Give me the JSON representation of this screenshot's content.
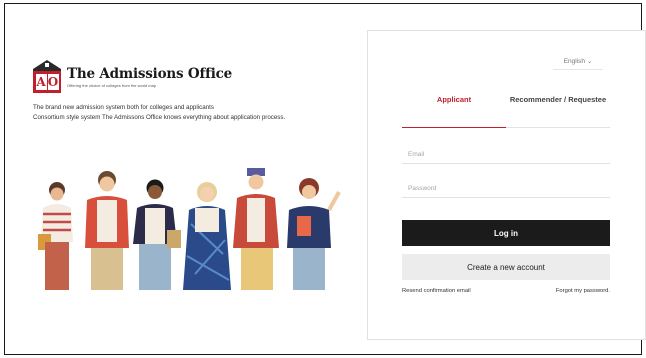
{
  "brand": {
    "logo_letters": [
      "A",
      "O"
    ],
    "title": "The Admissions Office",
    "tagline": "Offering the choice of colleges from the world map",
    "accent_color": "#c0202e"
  },
  "description": {
    "line1": "The brand new admission system both for colleges and applicants",
    "line2": "Consortium style system The Admissons Office knows everything about application process."
  },
  "illustration": {
    "icon": "group-of-students-illustration"
  },
  "login": {
    "language": "English ⌄",
    "tabs": [
      {
        "label": "Applicant",
        "active": true
      },
      {
        "label": "Recommender / Requestee",
        "active": false
      }
    ],
    "email_placeholder": "Email",
    "password_placeholder": "Password",
    "login_label": "Log in",
    "create_label": "Create a new account",
    "resend_label": "Resend confirmation email",
    "forgot_label": "Forgot my password."
  }
}
